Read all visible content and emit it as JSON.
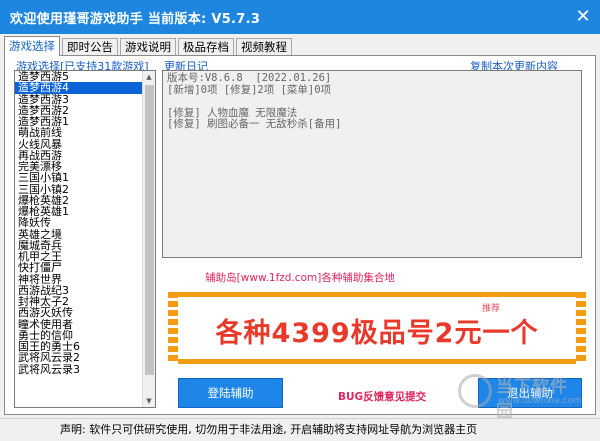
{
  "window": {
    "title": "欢迎使用瑾哥游戏助手  当前版本: V5.7.3",
    "close_glyph": "✕"
  },
  "tabs": [
    "游戏选择",
    "即时公告",
    "游戏说明",
    "极品存档",
    "视频教程"
  ],
  "labels": {
    "game_select": "游戏选择[已支持31款游戏]",
    "changelog": "更新日记",
    "copy_update": "复制本次更新内容"
  },
  "games": [
    "造梦西游5",
    "造梦西游4",
    "造梦西游3",
    "造梦西游2",
    "造梦西游1",
    "萌战前线",
    "火线风暴",
    "再战西游",
    "完美漂移",
    "三国小镇1",
    "三国小镇2",
    "爆枪英雄2",
    "爆枪英雄1",
    "降妖传",
    "英雄之境",
    "魔城奇兵",
    "机甲之王",
    "快打僵尸",
    "神将世界",
    "西游战纪3",
    "封神太子2",
    "西游灭妖传",
    "瞳术使用者",
    "勇士的信仰",
    "国王的勇士6",
    "武将风云录2",
    "武将风云录3"
  ],
  "selected_game_index": 1,
  "changelog": [
    "版本号:V8.6.8  [2022.01.26]",
    "[新增]0项 [修复]2项 [菜单]0项",
    "",
    "[修复] 人物血魔 无限魔法",
    "[修复] 刷图必备一 无敌秒杀[备用]"
  ],
  "promo": "辅助岛[www.1fzd.com]各种辅助集合地",
  "banner": {
    "text": "各种4399极品号2元一个",
    "tag": "推荐"
  },
  "buttons": {
    "login": "登陆辅助",
    "bug": "BUG反馈意见提交",
    "exit": "退出辅助"
  },
  "status": "声明: 软件只可供研究使用, 切勿用于非法用途, 开启辅助将支持网址导航为浏览器主页",
  "watermark": {
    "text": "当下软件园",
    "sub": "www.downxia.com"
  },
  "colors": {
    "titlebar": "#1f86e0",
    "accent_blue": "#1b5fc2",
    "selection": "#0a64d8",
    "promo_pink": "#e0245e",
    "banner_orange": "#f39c12",
    "banner_text": "#e8392b"
  }
}
